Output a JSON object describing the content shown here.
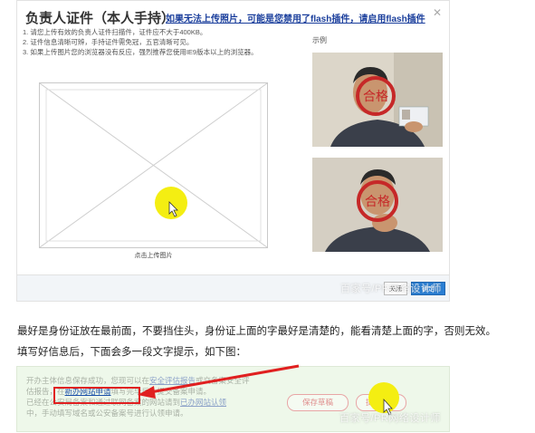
{
  "dialog": {
    "title": "负责人证件（本人手持）",
    "warning_link": "如果无法上传照片，可能是您禁用了flash插件，请启用flash插件",
    "instructions": [
      "1. 请您上传有效的负责人证件扫描件，证件应不大于400KB。",
      "2. 证件信息清晰可辨，手持证件需免冠，五官清晰可见。",
      "3. 如果上传图片您的浏览器没有反应，强烈推荐您使用IE9版本以上的浏览器。"
    ],
    "upload_label": "点击上传图片",
    "example_label": "示例",
    "close_label": "关闭",
    "ok_label": "确定"
  },
  "article": {
    "paragraph_1": "最好是身份证放在最前面，不要挡住头，身份证上面的字最好是清楚的，能看清楚上面的字，否则无效。",
    "paragraph_2": "填写好信息后，下面会多一段文字提示，如下图："
  },
  "snippet": {
    "line_1_a": "开办主体信息保存成功，您现可以在",
    "line_1_link": "安全评估报告",
    "line_1_b": "或交备案安全评",
    "line_2_a": "估报告，在",
    "line_2_highlight": "新办网站申请",
    "line_2_b": "填写完毕后，提交备案申请。",
    "line_3_a": "已经在公安局备案和通过联网备案的网站请到",
    "line_3_link": "已办网站认领",
    "line_3_b": "中，手动填写域名或公安备案号进行认领申请。",
    "save_draft_label": "保存草稿",
    "submit_label": "提交审核"
  },
  "watermark": "百家号/PR网络设计师",
  "colors": {
    "title_link": "#1a3e9c",
    "ok_button": "#2a7fd4",
    "highlight_box": "#e02020",
    "cursor": "#f4ee12",
    "snippet_bg": "#eef8ea"
  },
  "icons": {
    "close": "close-icon",
    "cursor": "pointer-cursor-icon",
    "arrow": "red-arrow-annotation"
  }
}
